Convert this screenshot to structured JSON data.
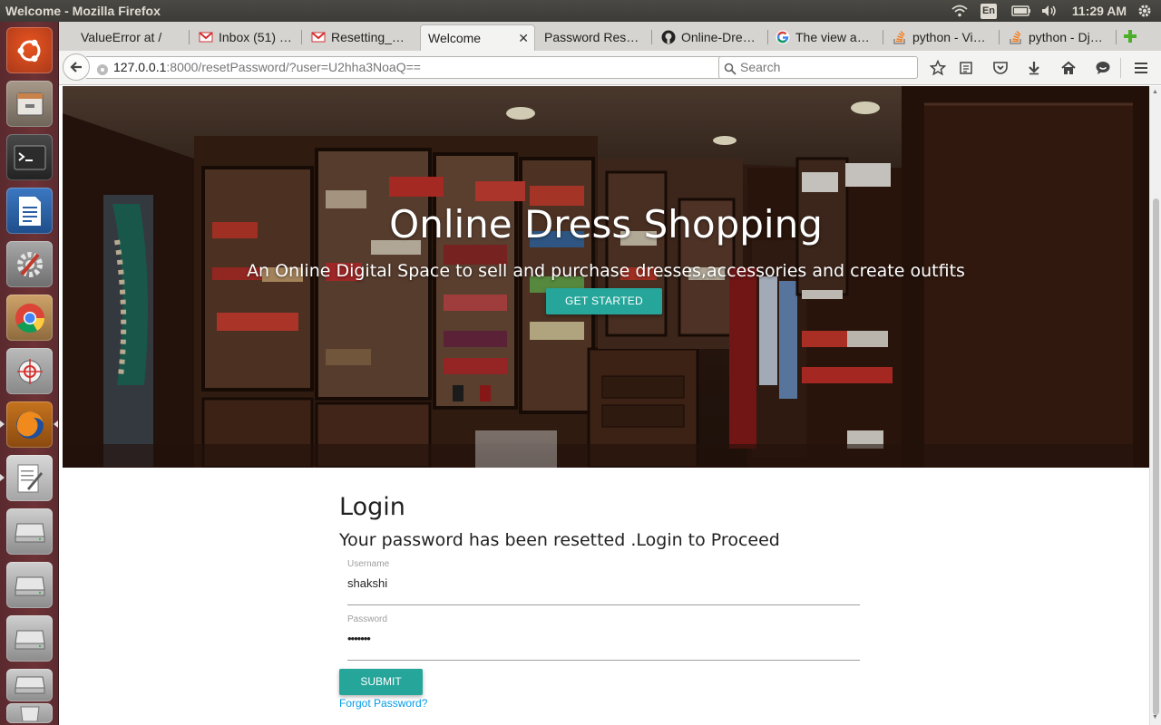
{
  "os": {
    "window_title": "Welcome - Mozilla Firefox",
    "keyboard_layout": "En",
    "clock": "11:29 AM"
  },
  "launcher": {
    "apps": [
      {
        "name": "ubuntu-dash-icon"
      },
      {
        "name": "files-icon"
      },
      {
        "name": "terminal-icon"
      },
      {
        "name": "libreoffice-writer-icon"
      },
      {
        "name": "system-settings-icon"
      },
      {
        "name": "chrome-icon"
      },
      {
        "name": "screenshot-tool-icon"
      },
      {
        "name": "firefox-icon"
      },
      {
        "name": "text-editor-icon"
      },
      {
        "name": "drive-icon"
      },
      {
        "name": "drive-icon"
      },
      {
        "name": "drive-icon"
      },
      {
        "name": "drive-icon"
      },
      {
        "name": "trash-icon"
      }
    ]
  },
  "browser": {
    "tabs": [
      {
        "label": "ValueError at /",
        "icon": "none"
      },
      {
        "label": "Inbox (51) …",
        "icon": "gmail-icon"
      },
      {
        "label": "Resetting_…",
        "icon": "gmail-icon"
      },
      {
        "label": "Welcome",
        "icon": "none",
        "active": true
      },
      {
        "label": "Password Res…",
        "icon": "none"
      },
      {
        "label": "Online-Dre…",
        "icon": "github-icon"
      },
      {
        "label": "The view a…",
        "icon": "google-icon"
      },
      {
        "label": "python - Vi…",
        "icon": "stackoverflow-icon"
      },
      {
        "label": "python - Dj…",
        "icon": "stackoverflow-icon"
      }
    ],
    "url_host": "127.0.0.1",
    "url_rest": ":8000/resetPassword/?user=U2hha3NoaQ==",
    "search_placeholder": "Search"
  },
  "page": {
    "hero_title": "Online Dress Shopping",
    "hero_subtitle": "An Online Digital Space to sell and purchase dresses,accessories and create outfits",
    "cta_label": "GET STARTED",
    "login_heading": "Login",
    "login_message": "Your password has been resetted .Login to Proceed",
    "username_label": "Username",
    "username_value": "shakshi",
    "password_label": "Password",
    "password_value": "•••••••",
    "submit_label": "SUBMIT",
    "forgot_label": "Forgot Password?"
  },
  "colors": {
    "accent": "#26a69a",
    "link": "#039be5",
    "launcher_bg": "#6d3236"
  }
}
